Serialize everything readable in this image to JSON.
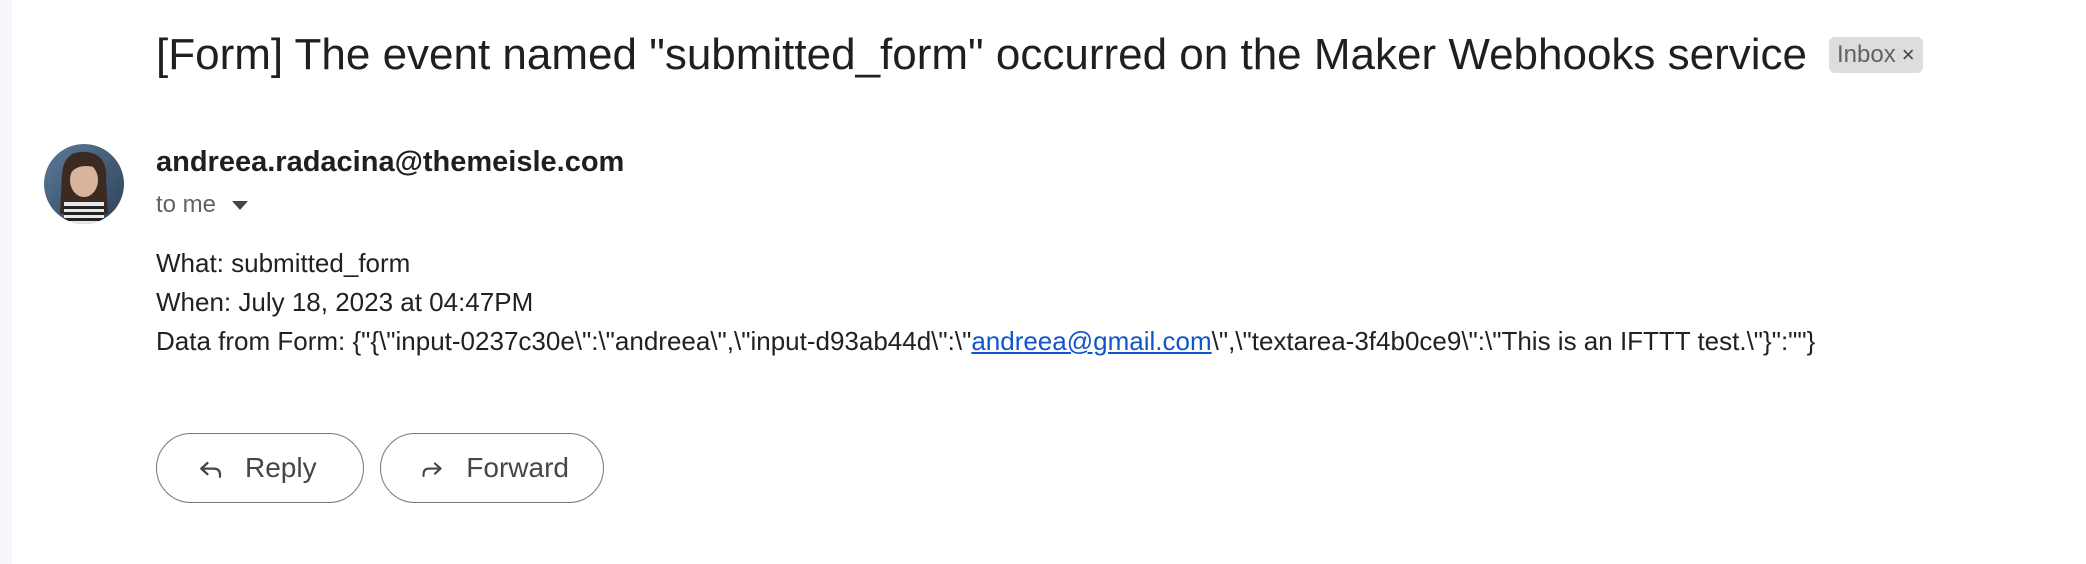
{
  "email": {
    "subject": "[Form] The event named \"submitted_form\" occurred on the Maker Webhooks service",
    "label": "Inbox",
    "sender": "andreea.radacina@themeisle.com",
    "recipient": "to me",
    "body": {
      "what_line": "What: submitted_form",
      "when_line": "When: July 18, 2023 at 04:47PM",
      "data_prefix": "Data from Form: {\"{\\\"input-0237c30e\\\":\\\"andreea\\\",\\\"input-d93ab44d\\\":\\\"",
      "data_link": "andreea@gmail.com",
      "data_suffix": "\\\",\\\"textarea-3f4b0ce9\\\":\\\"This is an IFTTT test.\\\"}\":\"\"}"
    }
  },
  "actions": {
    "reply_label": "Reply",
    "forward_label": "Forward"
  },
  "icons": {
    "label_close": "close-icon",
    "recipient_caret": "caret-down-icon",
    "reply": "reply-icon",
    "forward": "forward-icon"
  },
  "colors": {
    "link": "#1155cc",
    "label_bg": "#dddddd"
  }
}
